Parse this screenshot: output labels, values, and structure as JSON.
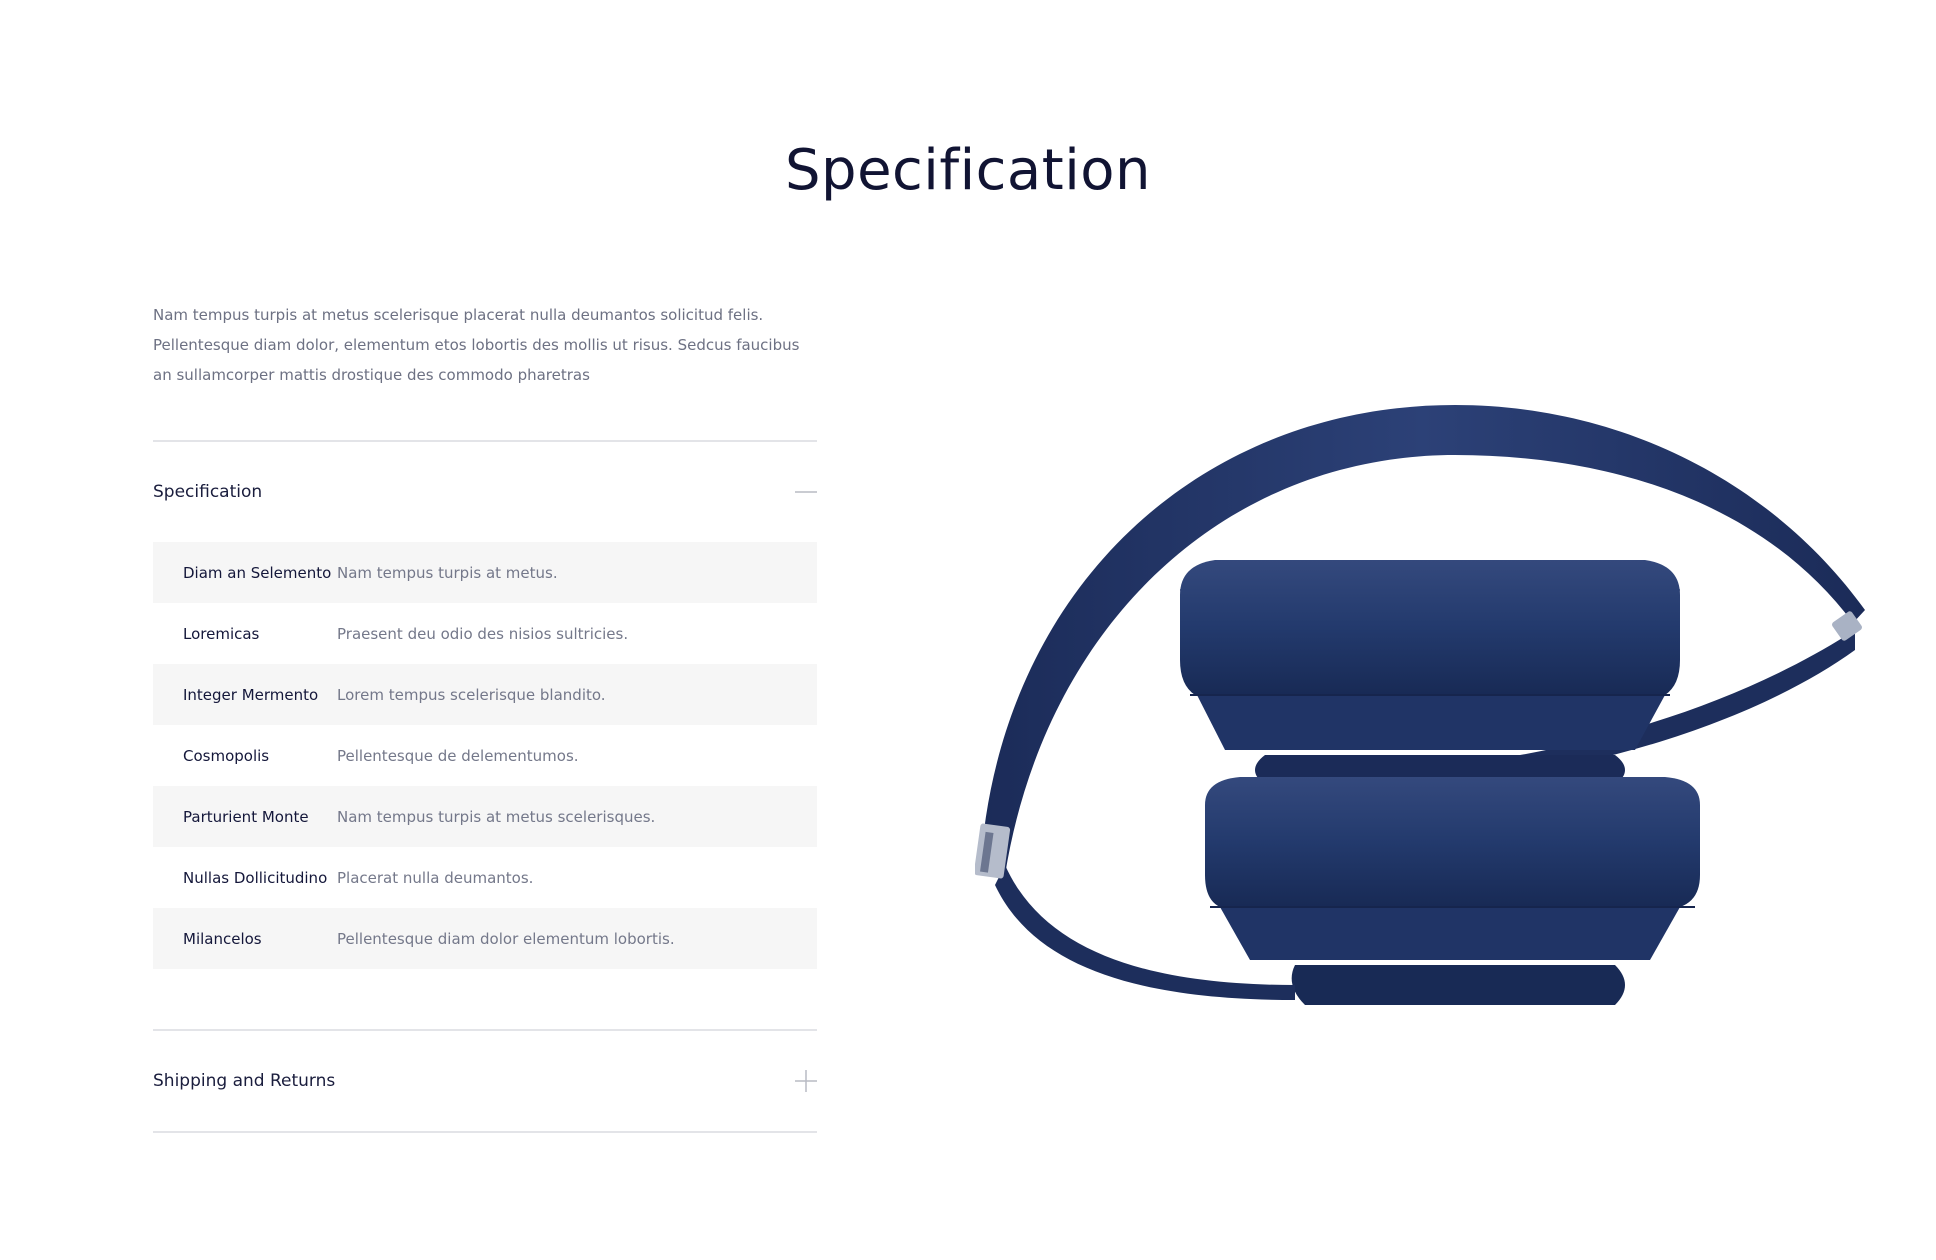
{
  "page": {
    "title": "Specification"
  },
  "intro_text": "Nam tempus turpis at metus scelerisque placerat nulla deumantos solicitud felis. Pellentesque diam dolor, elementum etos lobortis des mollis ut risus. Sedcus faucibus an sullamcorper mattis drostique des commodo pharetras",
  "accordion": {
    "specification": {
      "title": "Specification",
      "state": "expanded",
      "toggle_icon": "minus-icon",
      "rows": [
        {
          "key": "Diam an Selemento",
          "value": "Nam tempus turpis at metus."
        },
        {
          "key": "Loremicas",
          "value": "Praesent deu odio des nisios sultricies."
        },
        {
          "key": "Integer Mermento",
          "value": "Lorem tempus scelerisque blandito."
        },
        {
          "key": "Cosmopolis",
          "value": "Pellentesque de delementumos."
        },
        {
          "key": "Parturient Monte",
          "value": "Nam tempus turpis at metus scelerisques."
        },
        {
          "key": "Nullas Dollicitudino",
          "value": "Placerat nulla deumantos."
        },
        {
          "key": "Milancelos",
          "value": "Pellentesque diam dolor elementum lobortis."
        }
      ]
    },
    "shipping": {
      "title": "Shipping and Returns",
      "state": "collapsed",
      "toggle_icon": "plus-icon"
    }
  },
  "image": {
    "subject": "headphones-image"
  },
  "colors": {
    "title": "#111433",
    "text": "#6d7183",
    "row_shade": "#f6f6f6",
    "divider": "#e3e4e8",
    "headphones": "#1f2f5f"
  }
}
